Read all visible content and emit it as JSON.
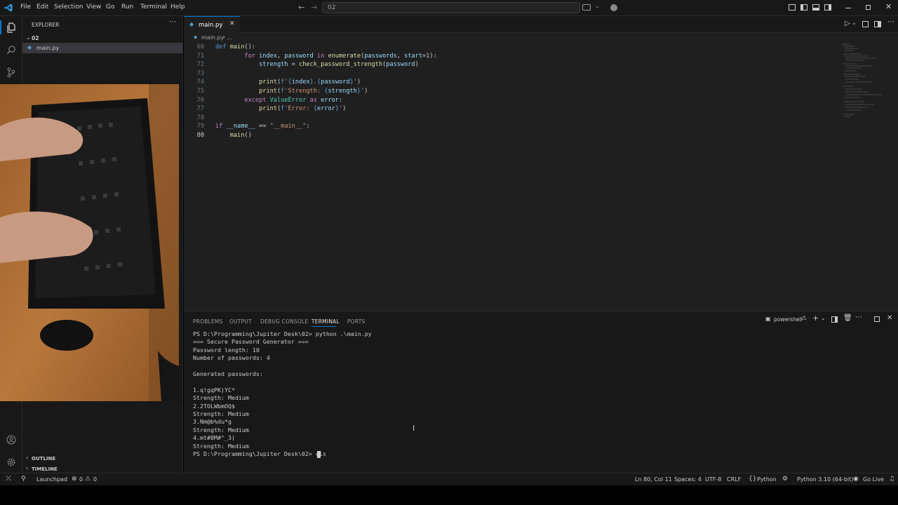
{
  "menu": [
    "File",
    "Edit",
    "Selection",
    "View",
    "Go",
    "Run",
    "Terminal",
    "Help"
  ],
  "command_center": {
    "text": "02"
  },
  "sidebar": {
    "title": "EXPLORER",
    "folder": "02",
    "files": [
      "main.py"
    ],
    "outline": "OUTLINE",
    "timeline": "TIMELINE"
  },
  "editor": {
    "tab": "main.py",
    "breadcrumb": {
      "file": "main.py",
      "rest": "..."
    },
    "lines": [
      {
        "n": "60",
        "tokens": [
          [
            "kw2",
            "def "
          ],
          [
            "fn",
            "main"
          ],
          [
            "",
            "():"
          ]
        ]
      },
      {
        "n": "71",
        "tokens": [
          [
            "",
            "        "
          ],
          [
            "kw",
            "for "
          ],
          [
            "var",
            "index"
          ],
          [
            "",
            ", "
          ],
          [
            "var",
            "password"
          ],
          [
            "kw",
            " in "
          ],
          [
            "fn",
            "enumerate"
          ],
          [
            "",
            "("
          ],
          [
            "var",
            "passwords"
          ],
          [
            "",
            ", "
          ],
          [
            "var",
            "start"
          ],
          [
            "",
            "="
          ],
          [
            "num",
            "1"
          ],
          [
            "",
            "):"
          ]
        ]
      },
      {
        "n": "72",
        "tokens": [
          [
            "",
            "            "
          ],
          [
            "var",
            "strength"
          ],
          [
            "",
            " = "
          ],
          [
            "fn",
            "check_password_strength"
          ],
          [
            "",
            "("
          ],
          [
            "var",
            "password"
          ],
          [
            "",
            ")"
          ]
        ]
      },
      {
        "n": "73",
        "tokens": []
      },
      {
        "n": "74",
        "tokens": [
          [
            "",
            "            "
          ],
          [
            "fn",
            "print"
          ],
          [
            "",
            "("
          ],
          [
            "kw2",
            "f"
          ],
          [
            "str",
            "'"
          ],
          [
            "kw2",
            "{"
          ],
          [
            "var",
            "index"
          ],
          [
            "kw2",
            "}"
          ],
          [
            "str",
            "."
          ],
          [
            "kw2",
            "{"
          ],
          [
            "var",
            "password"
          ],
          [
            "kw2",
            "}"
          ],
          [
            "str",
            "'"
          ],
          [
            "",
            ")"
          ]
        ]
      },
      {
        "n": "75",
        "tokens": [
          [
            "",
            "            "
          ],
          [
            "fn",
            "print"
          ],
          [
            "",
            "("
          ],
          [
            "kw2",
            "f"
          ],
          [
            "str",
            "'Strength: "
          ],
          [
            "kw2",
            "{"
          ],
          [
            "var",
            "strength"
          ],
          [
            "kw2",
            "}"
          ],
          [
            "str",
            "'"
          ],
          [
            "",
            ")"
          ]
        ]
      },
      {
        "n": "76",
        "tokens": [
          [
            "",
            "        "
          ],
          [
            "kw",
            "except "
          ],
          [
            "cls",
            "ValueError"
          ],
          [
            "kw",
            " as "
          ],
          [
            "var",
            "error"
          ],
          [
            "",
            ":"
          ]
        ]
      },
      {
        "n": "77",
        "tokens": [
          [
            "",
            "            "
          ],
          [
            "fn",
            "print"
          ],
          [
            "",
            "("
          ],
          [
            "kw2",
            "f"
          ],
          [
            "str",
            "'Error: "
          ],
          [
            "kw2",
            "{"
          ],
          [
            "var",
            "error"
          ],
          [
            "kw2",
            "}"
          ],
          [
            "str",
            "'"
          ],
          [
            "",
            ")"
          ]
        ]
      },
      {
        "n": "78",
        "tokens": []
      },
      {
        "n": "79",
        "tokens": [
          [
            "kw",
            "if "
          ],
          [
            "var",
            "__name__"
          ],
          [
            "",
            " == "
          ],
          [
            "str",
            "\"__main__\""
          ],
          [
            "",
            ":"
          ]
        ]
      },
      {
        "n": "80",
        "tokens": [
          [
            "",
            "    "
          ],
          [
            "fn",
            "main"
          ],
          [
            "",
            "()"
          ]
        ]
      }
    ]
  },
  "panel": {
    "tabs": [
      "PROBLEMS",
      "OUTPUT",
      "DEBUG CONSOLE",
      "TERMINAL",
      "PORTS"
    ],
    "active_tab": "TERMINAL",
    "shell": "powershell",
    "terminal_lines": [
      "PS D:\\Programming\\Jupiter Desk\\02> python .\\main.py",
      "=== Secure Password Generator ===",
      "Password length: 10",
      "Number of passwords: 4",
      "",
      "Generated passwords:",
      "",
      "1.q!gqPK)YC*",
      "Strength: Medium",
      "2.2TOLWbmOQ$",
      "Strength: Medium",
      "3.Nm@b%du*g",
      "Strength: Medium",
      "4.mt#8M#^_3)",
      "Strength: Medium",
      "PS D:\\Programming\\Jupiter Desk\\02> cls"
    ]
  },
  "status": {
    "remote": "",
    "launchpad": "Launchpad",
    "errors": "0",
    "warnings": "0",
    "position": "Ln 80, Col 11",
    "spaces": "Spaces: 4",
    "encoding": "UTF-8",
    "eol": "CRLF",
    "language": "Python",
    "interpreter": "Python 3.10 (64-bit)",
    "golive": "Go Live"
  },
  "colors": {
    "accent": "#0078d4",
    "bg_editor": "#1f1f1f",
    "bg_chrome": "#181818"
  }
}
